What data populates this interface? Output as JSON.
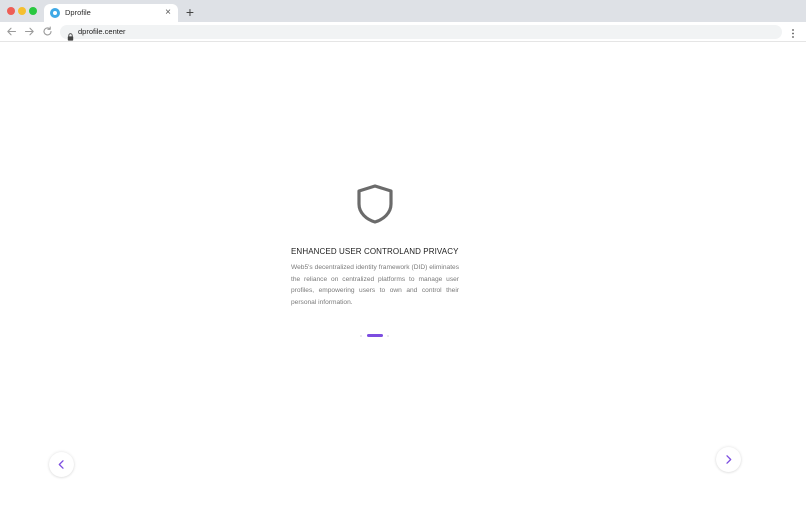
{
  "browser": {
    "tab_title": "Dprofile",
    "url": "dprofile.center",
    "new_tab_label": "+",
    "close_tab_label": "×"
  },
  "feature": {
    "title": "ENHANCED USER CONTROLAND PRIVACY",
    "description": "Web5's decentralized identity framework (DID) eliminates the reliance on centralized platforms to manage user profiles, empowering users to own and control their personal information.",
    "icon": "shield-icon"
  },
  "carousel": {
    "slide_count": 3,
    "active_index": 1,
    "accent_color": "#7c4de0"
  },
  "colors": {
    "accent": "#7c4de0",
    "icon_gray": "#6b6b6b"
  }
}
